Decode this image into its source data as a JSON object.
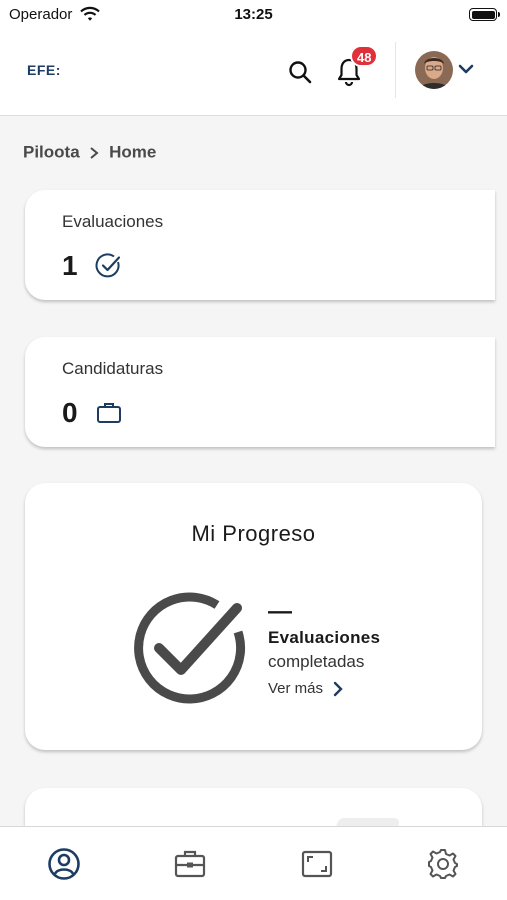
{
  "status_bar": {
    "carrier": "Operador",
    "time": "13:25"
  },
  "header": {
    "logo_text": "EFE:",
    "notification_count": "48"
  },
  "breadcrumb": {
    "root": "Piloota",
    "current": "Home"
  },
  "cards": {
    "evaluaciones": {
      "title": "Evaluaciones",
      "value": "1",
      "icon": "check-circle-icon"
    },
    "candidaturas": {
      "title": "Candidaturas",
      "value": "0",
      "icon": "briefcase-icon"
    }
  },
  "progress": {
    "title": "Mi Progreso",
    "value": "—",
    "label": "Evaluaciones",
    "sublabel": "completadas",
    "link": "Ver más"
  },
  "tabbar": {
    "items": [
      {
        "icon": "user-circle-icon",
        "active": true
      },
      {
        "icon": "toolbox-icon",
        "active": false
      },
      {
        "icon": "frame-icon",
        "active": false
      },
      {
        "icon": "gear-icon",
        "active": false
      }
    ]
  },
  "colors": {
    "brand": "#1d3c63",
    "badge": "#e0303b",
    "icon_gray": "#4a4a4a"
  }
}
